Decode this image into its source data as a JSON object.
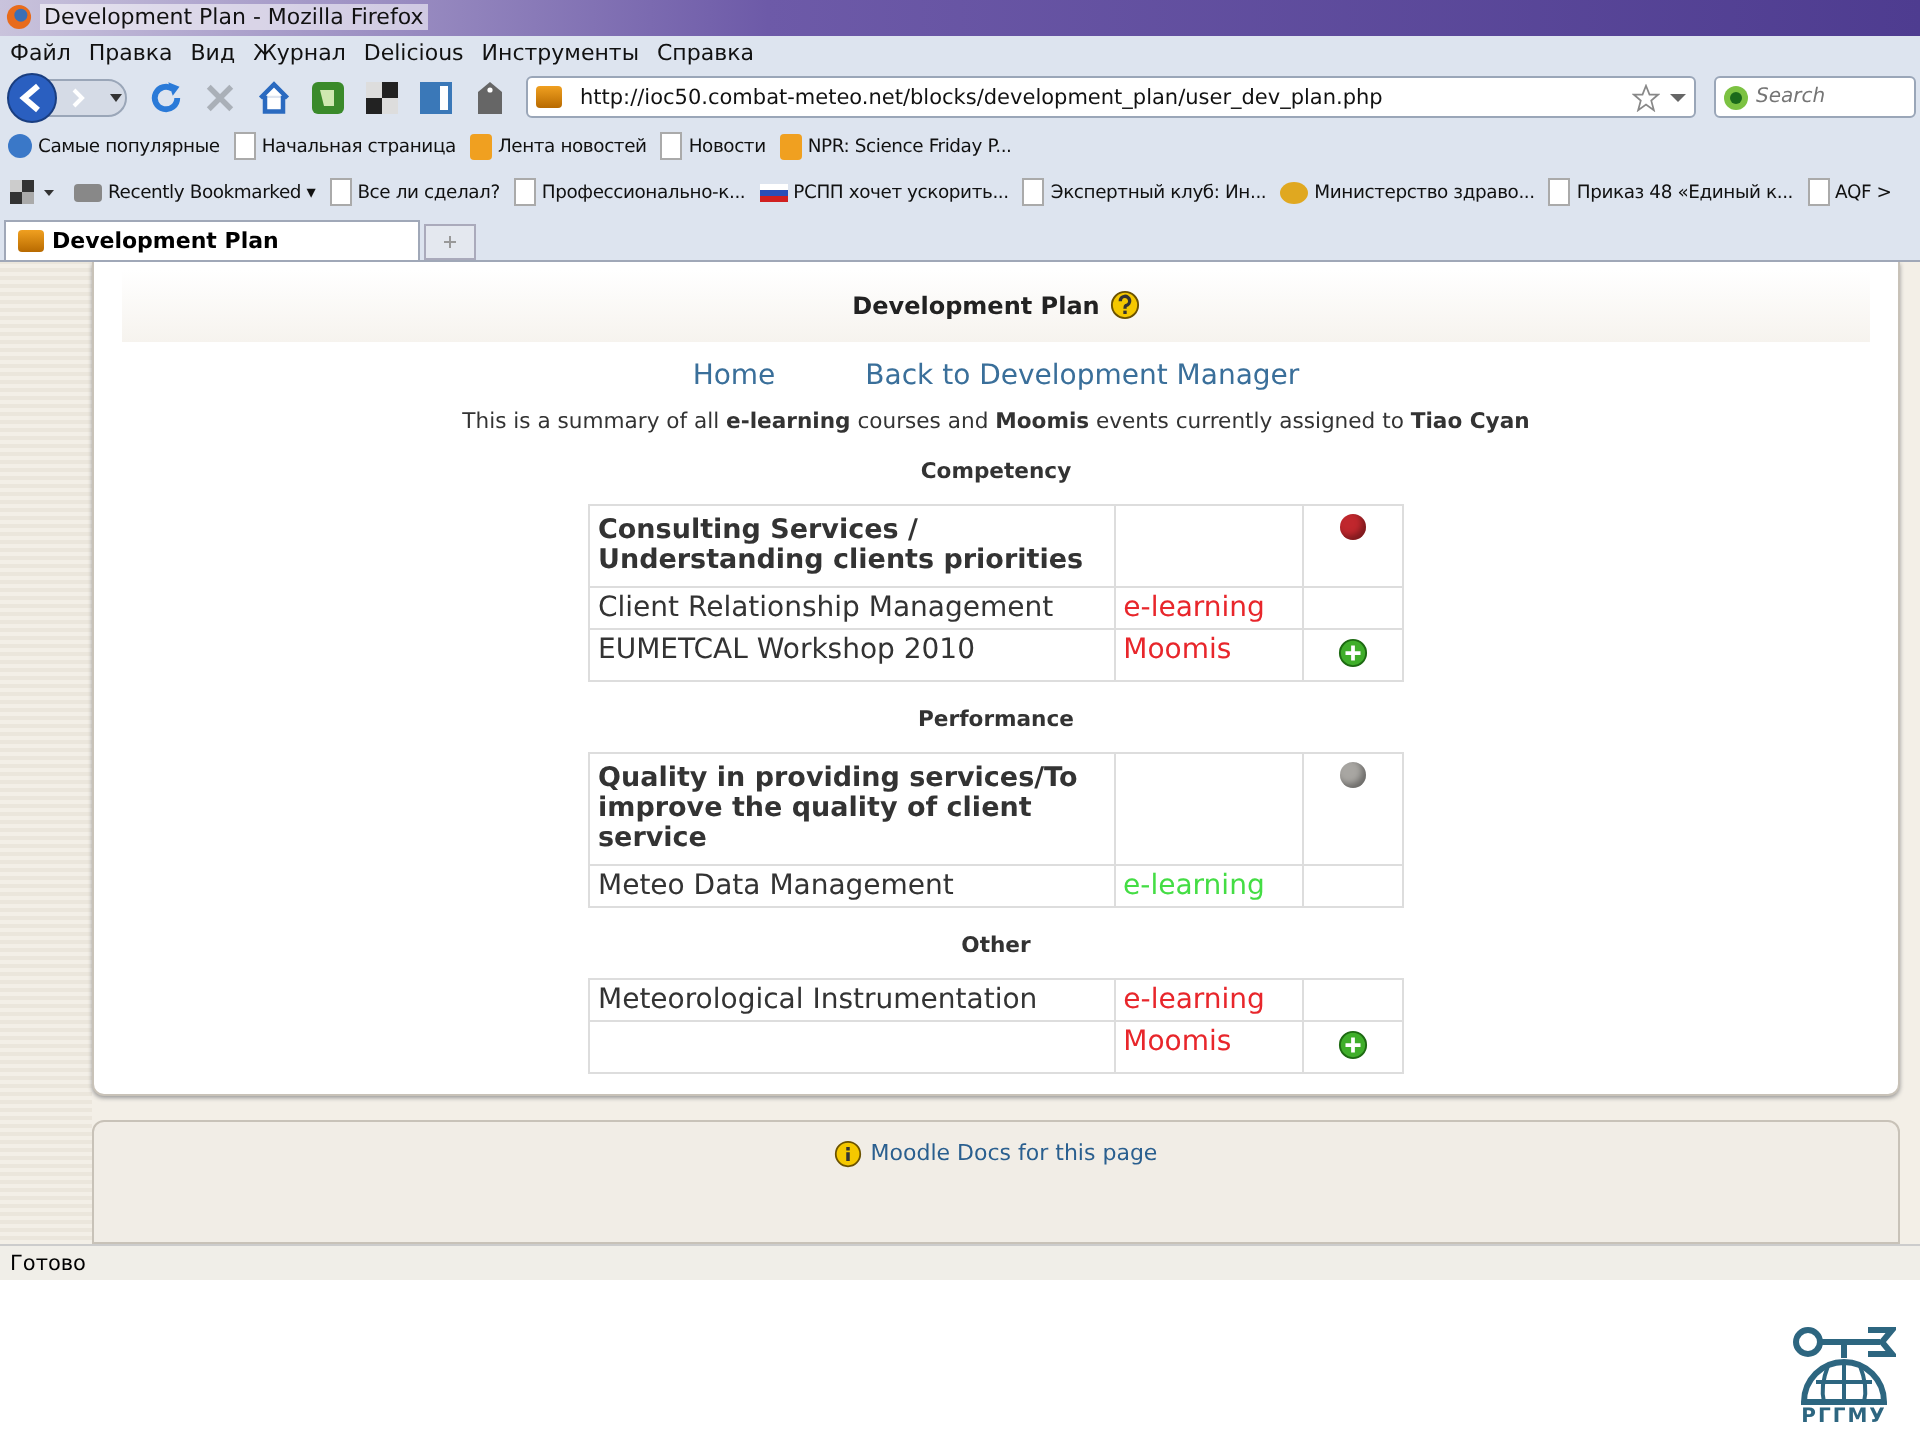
{
  "window": {
    "title": "Development Plan - Mozilla Firefox"
  },
  "menu": [
    "Файл",
    "Правка",
    "Вид",
    "Журнал",
    "Delicious",
    "Инструменты",
    "Справка"
  ],
  "address": {
    "value": "http://ioc50.combat-meteo.net/blocks/development_plan/user_dev_plan.php"
  },
  "search": {
    "placeholder": "Search"
  },
  "bookmarks": [
    {
      "kind": "search",
      "label": "Самые популярные"
    },
    {
      "kind": "page",
      "label": "Начальная страница"
    },
    {
      "kind": "rss",
      "label": "Лента новостей"
    },
    {
      "kind": "page",
      "label": "Новости"
    },
    {
      "kind": "rss",
      "label": "NPR: Science Friday P..."
    }
  ],
  "bookmarks2": [
    {
      "kind": "folder",
      "label": "Recently Bookmarked ▾"
    },
    {
      "kind": "page",
      "label": "Все ли сделал?"
    },
    {
      "kind": "page",
      "label": "Профессионально-к..."
    },
    {
      "kind": "flag",
      "label": "РСПП хочет ускорить..."
    },
    {
      "kind": "page",
      "label": "Экспертный клуб: Ин..."
    },
    {
      "kind": "coin",
      "label": "Министерство здраво..."
    },
    {
      "kind": "page",
      "label": "Приказ 48 «Единый к..."
    },
    {
      "kind": "page",
      "label": "AQF >"
    }
  ],
  "tabs": [
    {
      "label": "Development Plan",
      "selected": true
    }
  ],
  "page": {
    "heading": "Development Plan",
    "links": [
      "Home",
      "Back to Development Manager"
    ],
    "summary": "This is a summary of all **e-learning** courses and **Moomis** events currently assigned to **Tiao Cyan**",
    "sections": [
      {
        "title": "Competency",
        "rows": [
          {
            "kind": "header",
            "name": "Consulting Services / Understanding clients priorities",
            "color": "#c0272d"
          },
          {
            "kind": "item",
            "name": "Client Relationship Management",
            "type": "e-learning",
            "color": "#e8262b",
            "add": false
          },
          {
            "kind": "item",
            "name": "EUMETCAL Workshop 2010",
            "type": "Moomis",
            "color": "#e8262b",
            "add": true
          }
        ]
      },
      {
        "title": "Performance",
        "rows": [
          {
            "kind": "header",
            "name": "Quality in providing services/To improve the quality of client service",
            "color": "#a8a6a2"
          },
          {
            "kind": "item",
            "name": "Meteo Data Management",
            "type": "e-learning",
            "color": "#44dd44",
            "add": false
          }
        ]
      },
      {
        "title": "Other",
        "rows": [
          {
            "kind": "item",
            "name": "Meteorological Instrumentation",
            "type": "e-learning",
            "color": "#e8262b",
            "add": false
          },
          {
            "kind": "item",
            "name": "",
            "type": "Moomis",
            "color": "#e8262b",
            "add": true
          }
        ]
      }
    ]
  },
  "footer": {
    "link": "Moodle Docs for this page"
  },
  "status_bar": "Готово",
  "logo": {
    "text": "РГГМУ"
  }
}
